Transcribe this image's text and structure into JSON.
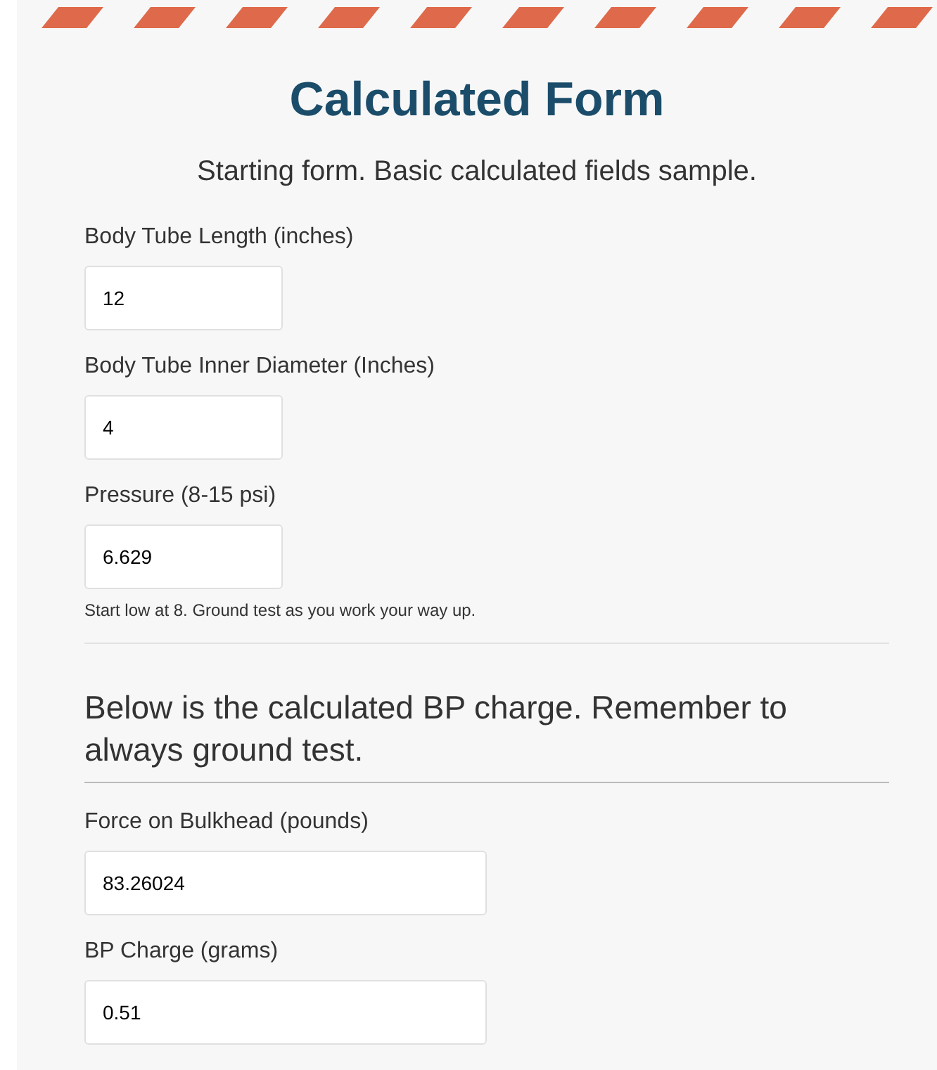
{
  "title": "Calculated Form",
  "subtitle": "Starting form. Basic calculated fields sample.",
  "fields": [
    {
      "label": "Body Tube Length (inches)",
      "value": "12",
      "kind": "short"
    },
    {
      "label": "Body Tube Inner Diameter (Inches)",
      "value": "4",
      "kind": "short"
    },
    {
      "label": "Pressure (8-15 psi)",
      "value": "6.629",
      "kind": "short",
      "help": "Start low at 8. Ground test as you work your way up."
    }
  ],
  "section_heading": "Below is the calculated BP charge. Remember to always ground test.",
  "results": [
    {
      "label": "Force on Bulkhead (pounds)",
      "value": "83.26024",
      "kind": "wide"
    },
    {
      "label": "BP Charge (grams)",
      "value": "0.51",
      "kind": "wide"
    }
  ]
}
